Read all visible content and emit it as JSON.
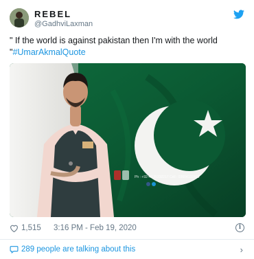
{
  "tweet": {
    "display_name": "REBEL",
    "handle": "@GadhviLaxman",
    "text_quote": "\" If the world is against pakistan then I'm with the world \"",
    "hashtag": "#UmarAkmalQuote",
    "likes": "1,515",
    "timestamp": "3:16 PM - Feb 19, 2020",
    "info_glyph": "i",
    "talking": "289 people are talking about this",
    "chevron": "›",
    "watermark": "Ph : +92-42 35332217  Cell : 03004132493"
  },
  "colors": {
    "link": "#1b95e0",
    "secondary": "#657786",
    "flag_green": "#0b5a33",
    "flag_white": "#f3f3f1"
  },
  "icons": [
    "twitter-bird-icon",
    "heart-icon",
    "info-icon",
    "speech-bubble-icon",
    "chevron-right-icon"
  ]
}
